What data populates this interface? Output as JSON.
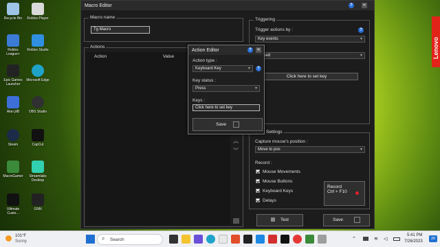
{
  "desktop": {
    "icons": [
      {
        "label": "Recycle Bin",
        "color": "#9ec5e8"
      },
      {
        "label": "Roblox Player",
        "color": "#d9d9d9"
      },
      {
        "label": "Roblox League+",
        "color": "#3b7bd6"
      },
      {
        "label": "Roblox Studio",
        "color": "#2f8fe0"
      },
      {
        "label": "Epic Games Launcher",
        "color": "#222222"
      },
      {
        "label": "Microsoft Edge",
        "color": "#1fa3c9"
      },
      {
        "label": "Alan jitB",
        "color": "#3d6fd8"
      },
      {
        "label": "OBS Studio",
        "color": "#303030"
      },
      {
        "label": "Steam",
        "color": "#1b2b48"
      },
      {
        "label": "CapCut",
        "color": "#111111"
      },
      {
        "label": "MacroGamer",
        "color": "#3a8a3a"
      },
      {
        "label": "Streamlabs Desktop",
        "color": "#30d0b0"
      },
      {
        "label": "Ultimate Custo...",
        "color": "#111111"
      },
      {
        "label": "GNN",
        "color": "#222222"
      }
    ],
    "brand_strip": "Lenovo"
  },
  "window": {
    "title": "Macro Editor",
    "macro_name": {
      "label": "Macro name",
      "value": "Tg Macro"
    },
    "actions": {
      "label": "Actions",
      "columns": [
        "Action",
        "Value"
      ]
    },
    "triggering": {
      "label": "Triggering",
      "trigger_label": "Trigger actions by :",
      "trigger_value": "Key events",
      "second_value": "ressed",
      "set_key_button": "Click here to set key"
    },
    "settings": {
      "label": "Settings",
      "capture_label": "Capture mouse's position :",
      "capture_value": "Move to pos",
      "record_label": "Record :",
      "options": [
        "Mouse Movements",
        "Mouse Buttons",
        "Keyboard Keys",
        "Delays"
      ],
      "record_button_line1": "Record",
      "record_button_line2": "Ctrl + F10"
    },
    "test_button": "Test",
    "save_button": "Save"
  },
  "dialog": {
    "title": "Action Editor",
    "action_type_label": "Action type :",
    "action_type_value": "Keyboard Key",
    "key_status_label": "Key status :",
    "key_status_value": "Press",
    "keys_label": "Keys :",
    "keys_value": "Click here to set key",
    "save_button": "Save"
  },
  "taskbar": {
    "weather_temp": "101°F",
    "weather_desc": "Sunny",
    "search_placeholder": "Search",
    "time": "5:41 PM",
    "date": "7/26/2023",
    "notification_count": "20"
  },
  "colors": {
    "accent_blue": "#2a6fd6",
    "window_bg": "#1c1c1c",
    "record_dot": "#e0202a"
  }
}
